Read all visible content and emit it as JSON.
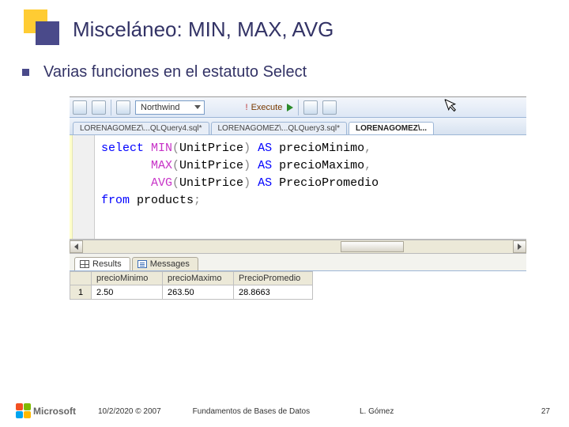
{
  "title": "Misceláneo: MIN, MAX, AVG",
  "subtitle": "Varias funciones en el estatuto Select",
  "toolbar": {
    "database": "Northwind",
    "execute_label": "Execute"
  },
  "tabs": [
    "LORENAGOMEZ\\...QLQuery4.sql*",
    "LORENAGOMEZ\\...QLQuery3.sql*",
    "LORENAGOMEZ\\..."
  ],
  "sql": {
    "tokens": [
      {
        "t": "select ",
        "c": "kw"
      },
      {
        "t": "MIN",
        "c": "fn"
      },
      {
        "t": "(",
        "c": "op"
      },
      {
        "t": "UnitPrice",
        "c": ""
      },
      {
        "t": ") ",
        "c": "op"
      },
      {
        "t": "AS",
        "c": "kw"
      },
      {
        "t": " precioMinimo",
        "c": ""
      },
      {
        "t": ",",
        "c": "op"
      },
      {
        "t": "\n       ",
        "c": ""
      },
      {
        "t": "MAX",
        "c": "fn"
      },
      {
        "t": "(",
        "c": "op"
      },
      {
        "t": "UnitPrice",
        "c": ""
      },
      {
        "t": ") ",
        "c": "op"
      },
      {
        "t": "AS",
        "c": "kw"
      },
      {
        "t": " precioMaximo",
        "c": ""
      },
      {
        "t": ",",
        "c": "op"
      },
      {
        "t": "\n       ",
        "c": ""
      },
      {
        "t": "AVG",
        "c": "fn"
      },
      {
        "t": "(",
        "c": "op"
      },
      {
        "t": "UnitPrice",
        "c": ""
      },
      {
        "t": ") ",
        "c": "op"
      },
      {
        "t": "AS",
        "c": "kw"
      },
      {
        "t": " PrecioPromedio",
        "c": ""
      },
      {
        "t": "\n",
        "c": ""
      },
      {
        "t": "from",
        "c": "kw"
      },
      {
        "t": " products",
        "c": ""
      },
      {
        "t": ";",
        "c": "op"
      }
    ]
  },
  "result_tabs": {
    "results": "Results",
    "messages": "Messages"
  },
  "grid": {
    "headers": [
      "precioMinimo",
      "precioMaximo",
      "PrecioPromedio"
    ],
    "row_index": "1",
    "row": [
      "2.50",
      "263.50",
      "28.8663"
    ]
  },
  "footer": {
    "brand": "Microsoft",
    "date": "10/2/2020 © 2007",
    "center": "Fundamentos de Bases de Datos",
    "author": "L. Gómez",
    "page": "27"
  }
}
